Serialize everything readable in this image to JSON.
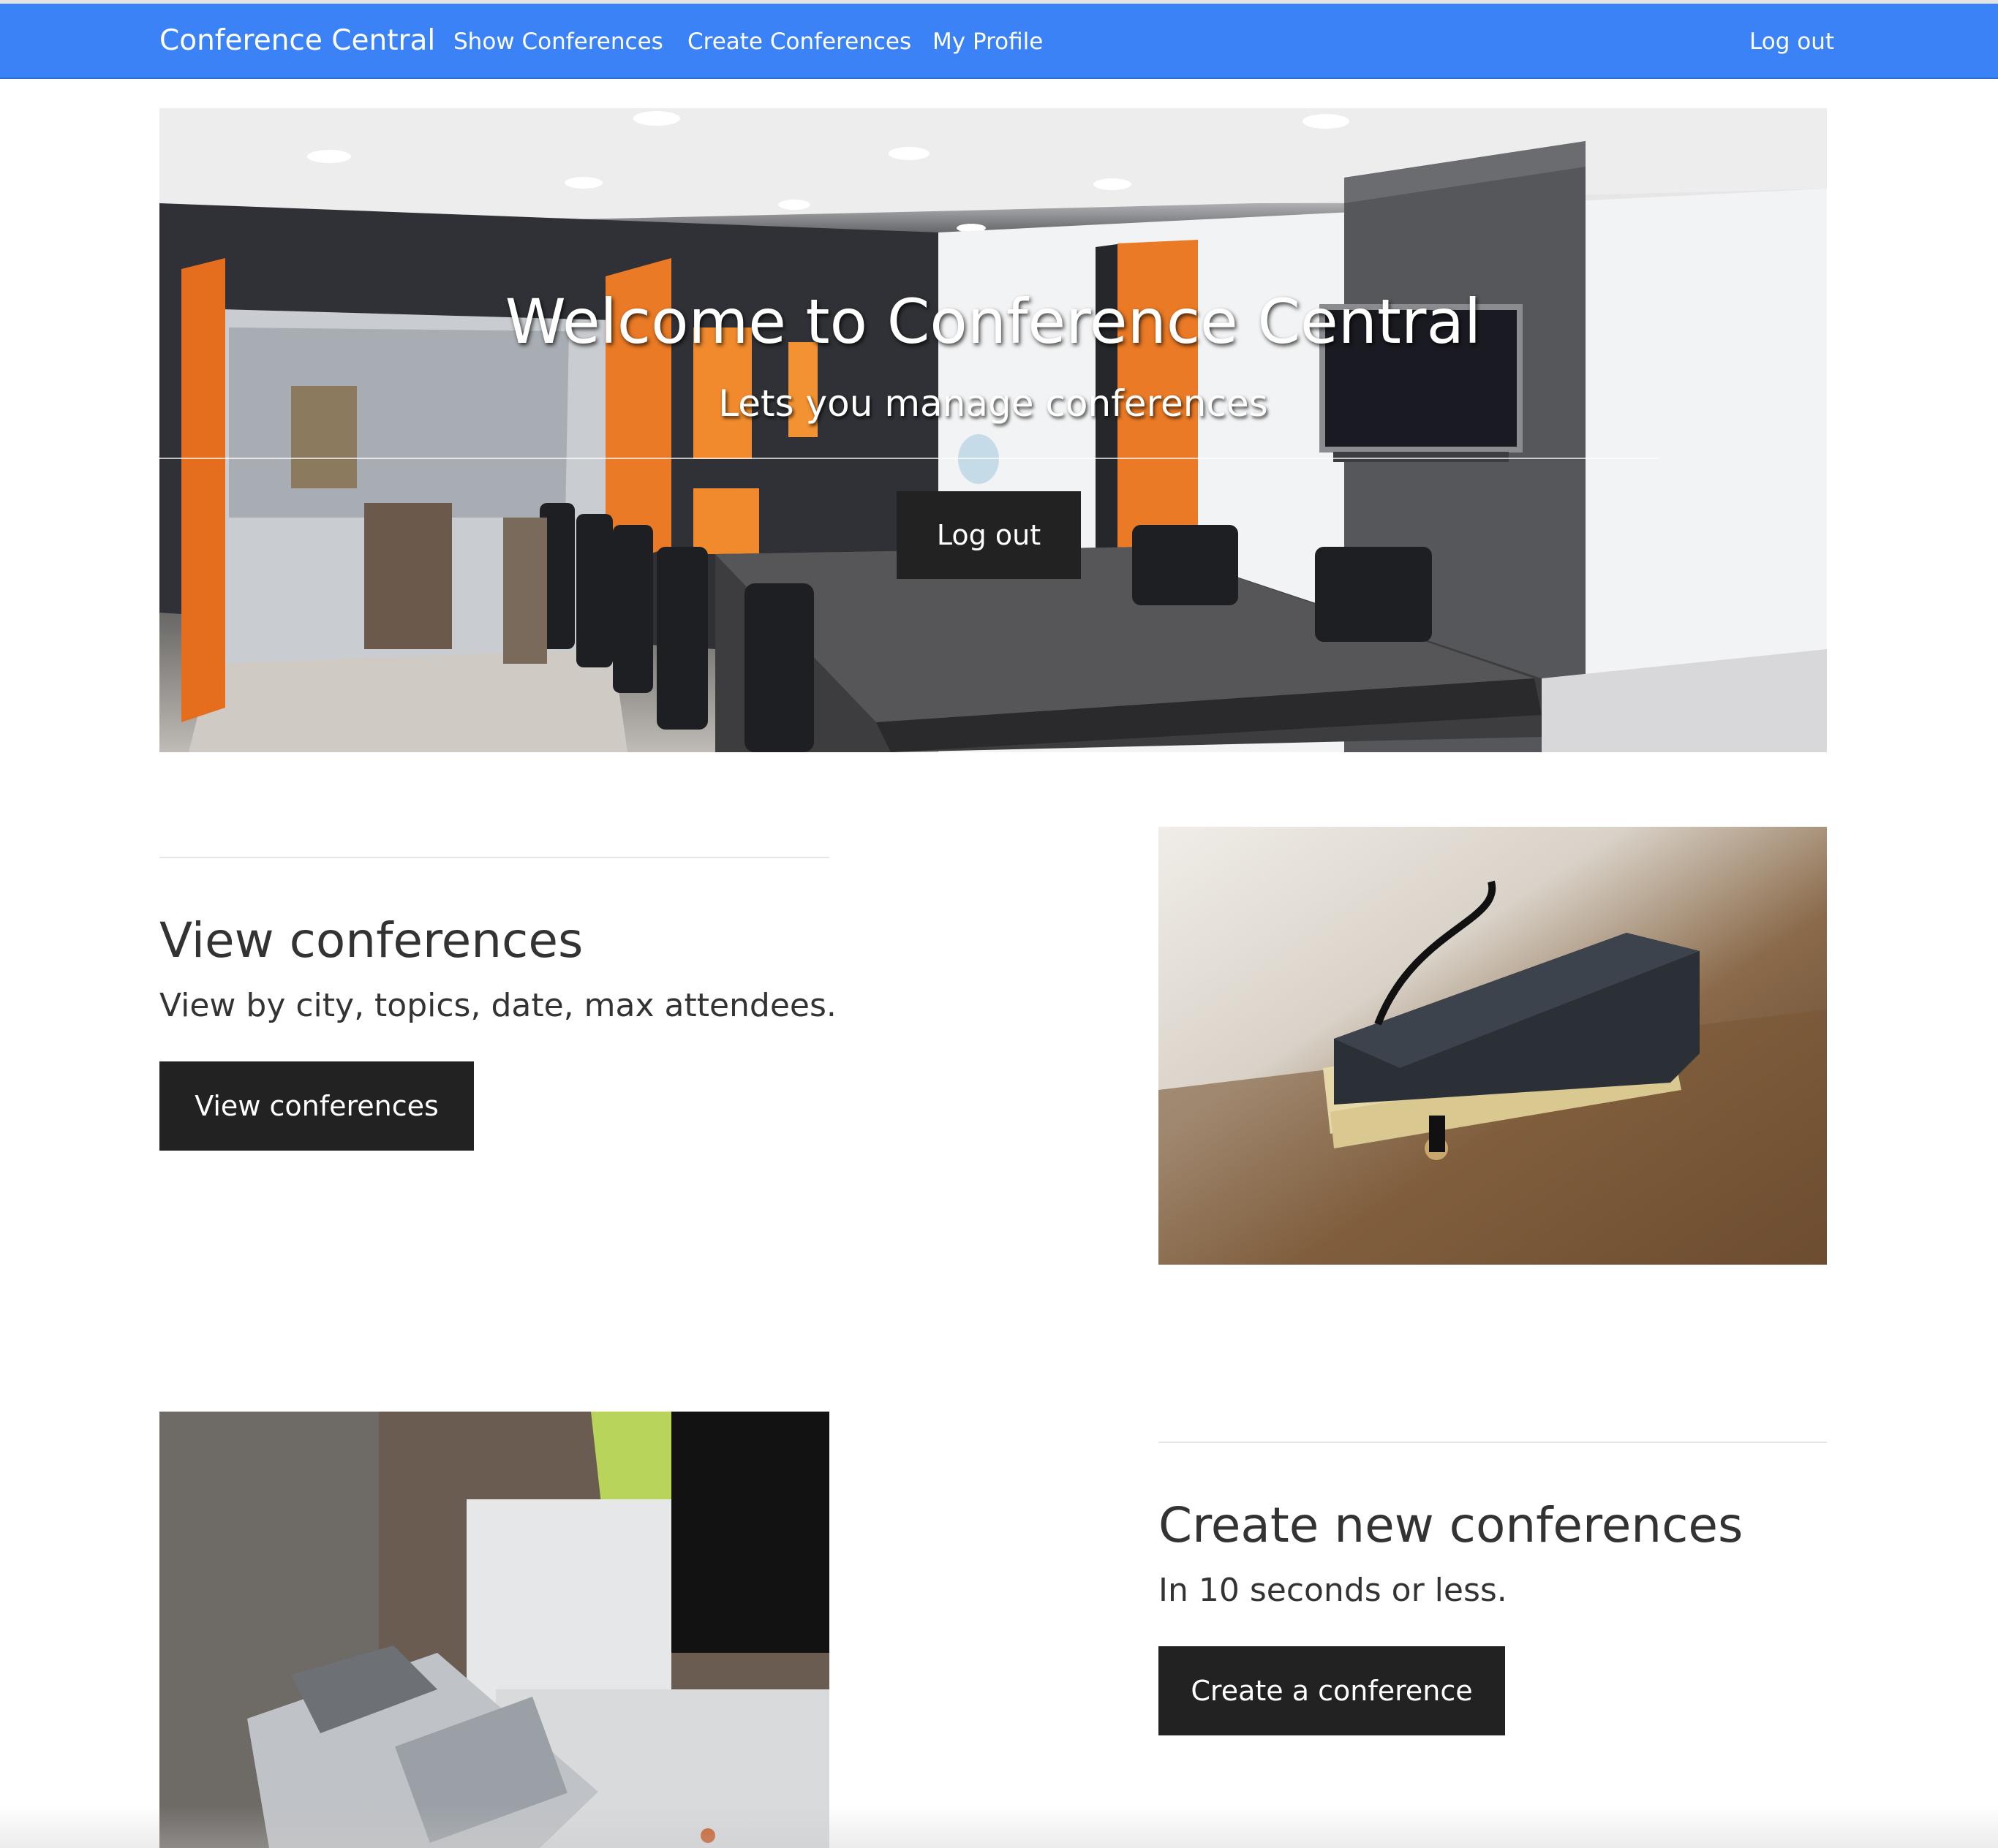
{
  "navbar": {
    "brand": "Conference Central",
    "links": [
      {
        "label": "Show Conferences"
      },
      {
        "label": "Create Conferences"
      },
      {
        "label": "My Profile"
      }
    ],
    "logout": "Log out",
    "color": "#3b82f6"
  },
  "hero": {
    "title": "Welcome to Conference Central",
    "subtitle": "Lets you manage conferences",
    "button": "Log out"
  },
  "sections": [
    {
      "heading": "View conferences",
      "text": "View by city, topics, date, max attendees.",
      "button": "View conferences"
    },
    {
      "heading": "Create new conferences",
      "text": "In 10 seconds or less.",
      "button": "Create a conference"
    }
  ],
  "colors": {
    "button_bg": "#222222",
    "text": "#333333",
    "divider": "#e6e6e6"
  }
}
